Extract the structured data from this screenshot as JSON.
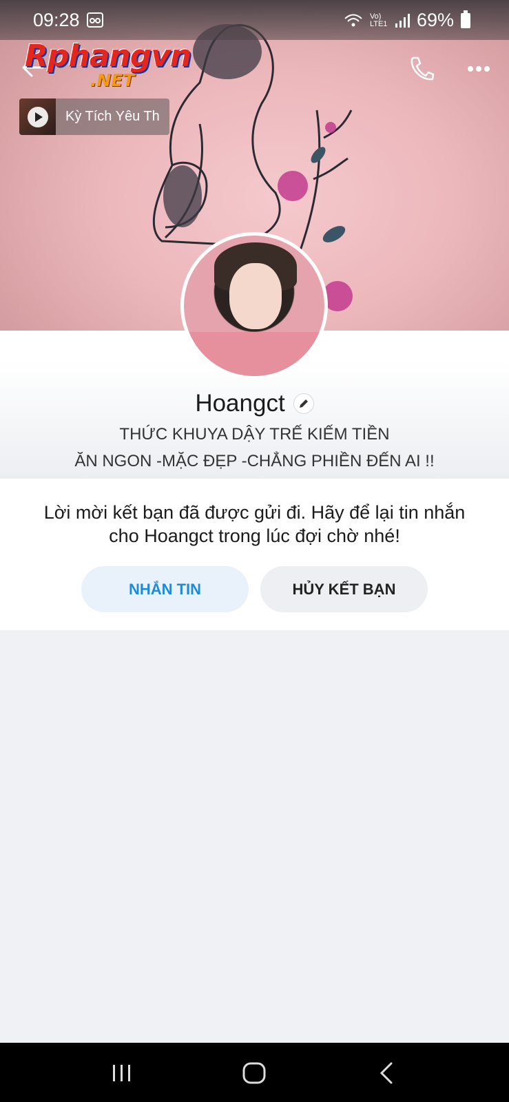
{
  "status_bar": {
    "time": "09:28",
    "network": "Vo) LTE1",
    "battery": "69%"
  },
  "watermark": {
    "main": "Rphangvn",
    "suffix": ".NET"
  },
  "music": {
    "title": "Kỳ Tích Yêu Th"
  },
  "profile": {
    "name": "Hoangct",
    "bio_line1": "THỨC KHUYA DẬY TRẾ KIẾM TIỀN",
    "bio_line2": "ĂN NGON -MẶC ĐẸP -CHẲNG PHIỀN ĐẾN AI !!"
  },
  "request": {
    "message": "Lời mời kết bạn đã được gửi đi. Hãy để lại tin nhắn cho Hoangct trong lúc đợi chờ nhé!",
    "message_button": "NHẮN TIN",
    "cancel_button": "HỦY KẾT BẠN"
  },
  "colors": {
    "accent": "#1f8ad6",
    "message_bg": "#e9f2fb",
    "page_bg": "#eff1f5"
  }
}
